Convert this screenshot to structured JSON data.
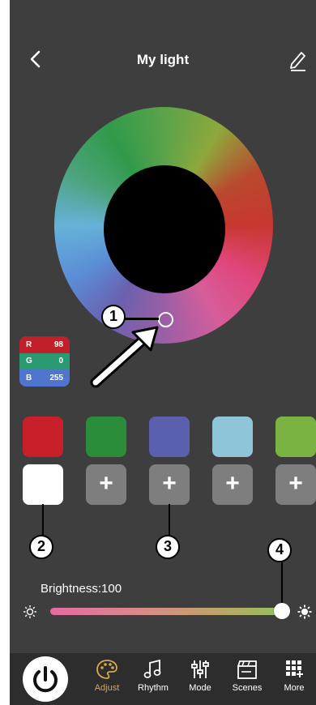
{
  "header": {
    "title": "My light"
  },
  "rgb": {
    "r_label": "R",
    "r_value": "98",
    "g_label": "G",
    "g_value": "0",
    "b_label": "B",
    "b_value": "255"
  },
  "swatches": {
    "row1": [
      "#c81f28",
      "#2b8c3a",
      "#5a5fae",
      "#8fc5d9",
      "#7bb342"
    ],
    "selected_custom": "#ffffff",
    "add_label": "+"
  },
  "annotations": [
    "1",
    "2",
    "3",
    "4"
  ],
  "brightness": {
    "label": "Brightness:100",
    "value": 100
  },
  "nav": {
    "items": [
      {
        "label": "Adjust",
        "icon": "palette-icon",
        "active": true
      },
      {
        "label": "Rhythm",
        "icon": "music-note-icon",
        "active": false
      },
      {
        "label": "Mode",
        "icon": "sliders-icon",
        "active": false
      },
      {
        "label": "Scenes",
        "icon": "clapperboard-icon",
        "active": false
      },
      {
        "label": "More",
        "icon": "grid-plus-icon",
        "active": false
      }
    ]
  },
  "colors": {
    "background": "#3e3e3e",
    "accent": "#d6a94e",
    "nav_bg": "#2d2d2d"
  }
}
